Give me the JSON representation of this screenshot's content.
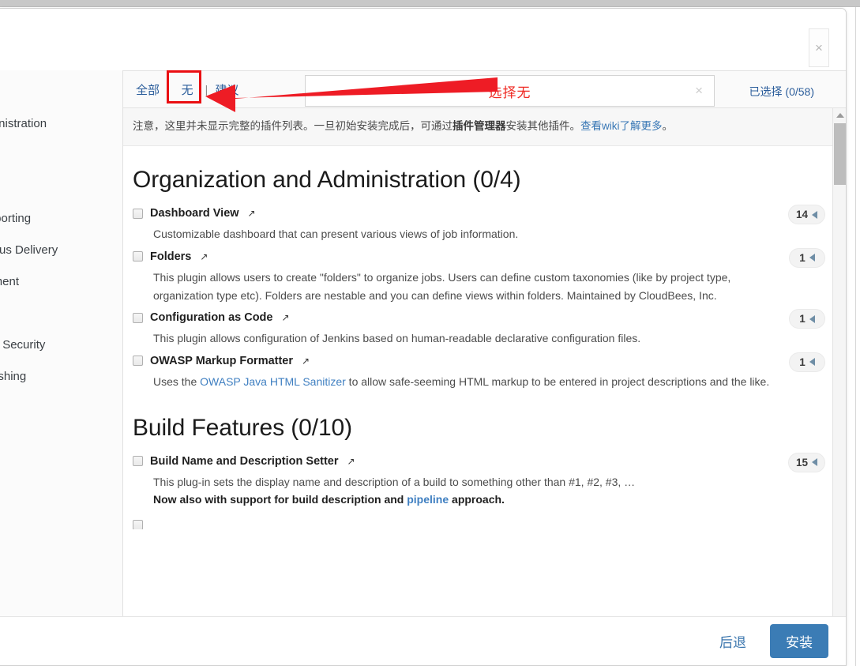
{
  "dialog": {
    "close_label": "×"
  },
  "toolbar": {
    "tabs": [
      {
        "label": "全部",
        "name": "tab-all",
        "highlighted": false
      },
      {
        "label": "无",
        "name": "tab-none",
        "highlighted": true
      },
      {
        "label": "建议",
        "name": "tab-suggested",
        "highlighted": false
      }
    ],
    "separator": "|",
    "search_placeholder": "选择无",
    "search_value": "",
    "clear_label": "×",
    "selected_label": "已选择",
    "selected_count": "(0/58)",
    "accent_color": "#3b7cb5",
    "highlight_color": "#ea0f12"
  },
  "sidebar": {
    "items": [
      {
        "label": "dministration"
      },
      {
        "label": ""
      },
      {
        "label": ""
      },
      {
        "label": "Reporting"
      },
      {
        "label": "nuous Delivery"
      },
      {
        "label": "gement"
      },
      {
        "label": ""
      },
      {
        "label": "and Security"
      },
      {
        "label": "ublishing"
      }
    ]
  },
  "notice": {
    "text_before": "注意，这里并未显示完整的插件列表。一旦初始安装完成后，可通过",
    "bold": "插件管理器",
    "text_middle": "安装其他插件。",
    "link": "查看wiki了解更多",
    "text_after": "。"
  },
  "sections": [
    {
      "title": "Organization and Administration (0/4)",
      "plugins": [
        {
          "name": "Dashboard View",
          "external_icon": "↗",
          "count": "14",
          "desc_parts": [
            {
              "type": "text",
              "value": "Customizable dashboard that can present various views of job information."
            }
          ]
        },
        {
          "name": "Folders",
          "external_icon": "↗",
          "count": "1",
          "desc_parts": [
            {
              "type": "text",
              "value": "This plugin allows users to create \"folders\" to organize jobs. Users can define custom taxonomies (like by project type, organization type etc). Folders are nestable and you can define views within folders. Maintained by CloudBees, Inc."
            }
          ]
        },
        {
          "name": "Configuration as Code",
          "external_icon": "↗",
          "count": "1",
          "desc_parts": [
            {
              "type": "text",
              "value": "This plugin allows configuration of Jenkins based on human-readable declarative configuration files."
            }
          ]
        },
        {
          "name": "OWASP Markup Formatter",
          "external_icon": "↗",
          "count": "1",
          "desc_parts": [
            {
              "type": "text",
              "value": "Uses the "
            },
            {
              "type": "link",
              "value": "OWASP Java HTML Sanitizer"
            },
            {
              "type": "text",
              "value": " to allow safe-seeming HTML markup to be entered in project descriptions and the like."
            }
          ]
        }
      ]
    },
    {
      "title": "Build Features (0/10)",
      "plugins": [
        {
          "name": "Build Name and Description Setter",
          "external_icon": "↗",
          "count": "15",
          "desc_parts": [
            {
              "type": "text",
              "value": "This plug-in sets the display name and description of a build to something other than #1, #2, #3, …"
            },
            {
              "type": "break",
              "value": ""
            },
            {
              "type": "bold",
              "value": "Now also with support for build description and "
            },
            {
              "type": "boldlink",
              "value": "pipeline"
            },
            {
              "type": "bold",
              "value": " approach."
            }
          ]
        }
      ]
    }
  ],
  "footer": {
    "back_label": "后退",
    "install_label": "安装"
  }
}
